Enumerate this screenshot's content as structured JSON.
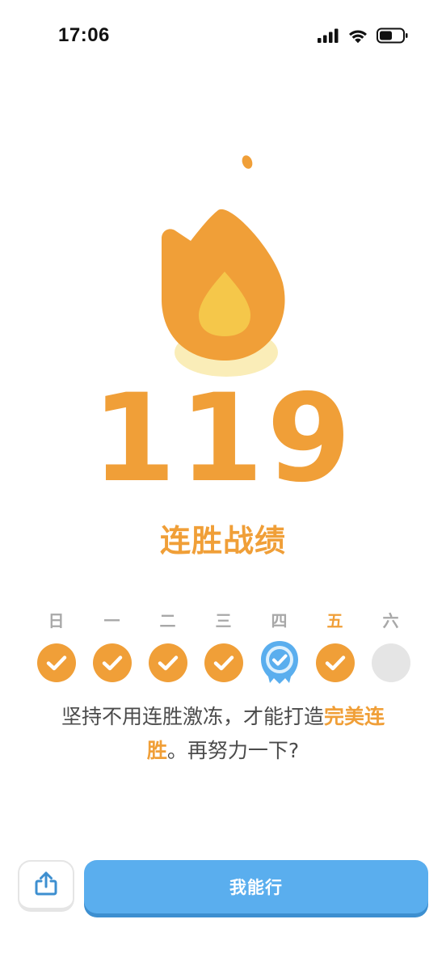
{
  "status_bar": {
    "time": "17:06",
    "icons": [
      "cellular-signal-icon",
      "wifi-icon",
      "battery-icon"
    ]
  },
  "streak": {
    "count": "119",
    "title": "连胜战绩"
  },
  "week": {
    "days": [
      {
        "label": "日",
        "state": "completed"
      },
      {
        "label": "一",
        "state": "completed"
      },
      {
        "label": "二",
        "state": "completed"
      },
      {
        "label": "三",
        "state": "completed"
      },
      {
        "label": "四",
        "state": "frozen"
      },
      {
        "label": "五",
        "state": "completed",
        "today": true
      },
      {
        "label": "六",
        "state": "empty"
      }
    ]
  },
  "message": {
    "part1": "坚持不用连胜激冻，才能打造",
    "highlight": "完美连胜",
    "part2": "。再努力一下?"
  },
  "actions": {
    "share_icon": "share-icon",
    "primary_label": "我能行"
  },
  "colors": {
    "accent_orange": "#f09f38",
    "flame_inner": "#f5c74a",
    "flame_glow": "#faedb8",
    "freeze_blue": "#5aaeee",
    "empty_gray": "#e5e5e5",
    "primary_button": "#5aaeee"
  }
}
